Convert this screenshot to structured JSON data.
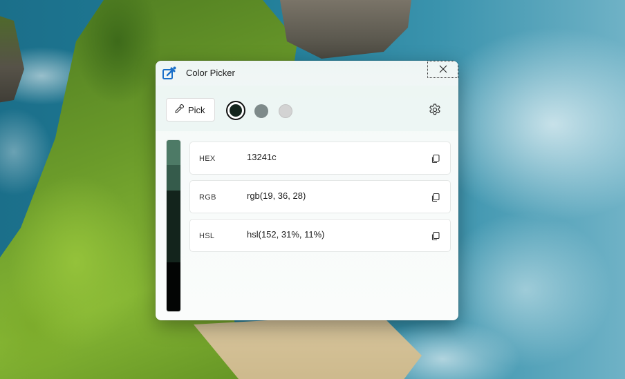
{
  "window": {
    "title": "Color Picker",
    "icon": "color-picker-app-icon",
    "close_icon": "close-icon"
  },
  "toolbar": {
    "pick_label": "Pick",
    "pick_icon": "eyedropper-icon",
    "settings_icon": "gear-icon",
    "swatches": [
      {
        "color": "#13241c",
        "selected": true
      },
      {
        "color": "#7e8a8a",
        "selected": false
      },
      {
        "color": "#d3d3d3",
        "selected": false
      }
    ]
  },
  "shades": [
    "#4d7a66",
    "#355b4b",
    "#13241c",
    "#0c1712",
    "#030504"
  ],
  "values": [
    {
      "label": "HEX",
      "value": "13241c",
      "copy_icon": "copy-icon"
    },
    {
      "label": "RGB",
      "value": "rgb(19, 36, 28)",
      "copy_icon": "copy-icon"
    },
    {
      "label": "HSL",
      "value": "hsl(152, 31%, 11%)",
      "copy_icon": "copy-icon"
    }
  ]
}
